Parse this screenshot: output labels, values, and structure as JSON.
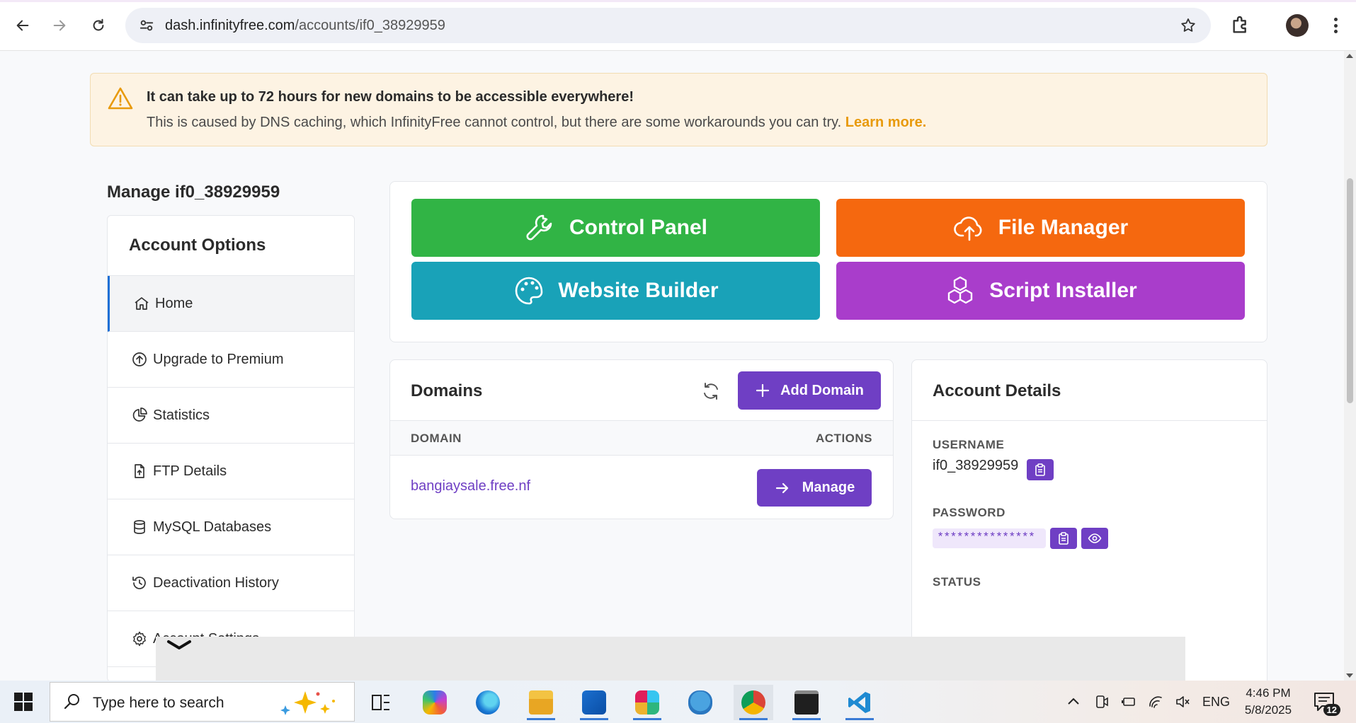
{
  "browser": {
    "url_host": "dash.infinityfree.com",
    "url_path": "/accounts/if0_38929959"
  },
  "alert": {
    "title": "It can take up to 72 hours for new domains to be accessible everywhere!",
    "message": "This is caused by DNS caching, which InfinityFree cannot control, but there are some workarounds you can try. ",
    "link": "Learn more."
  },
  "page_title": "Manage if0_38929959",
  "sidebar": {
    "heading": "Account Options",
    "items": [
      {
        "label": "Home",
        "icon": "home-icon"
      },
      {
        "label": "Upgrade to Premium",
        "icon": "arrow-up-circle-icon"
      },
      {
        "label": "Statistics",
        "icon": "pie-chart-icon"
      },
      {
        "label": "FTP Details",
        "icon": "file-upload-icon"
      },
      {
        "label": "MySQL Databases",
        "icon": "database-icon"
      },
      {
        "label": "Deactivation History",
        "icon": "history-icon"
      },
      {
        "label": "Account Settings",
        "icon": "gear-icon"
      }
    ]
  },
  "actions": {
    "control_panel": "Control Panel",
    "file_manager": "File Manager",
    "website_builder": "Website Builder",
    "script_installer": "Script Installer"
  },
  "domains": {
    "title": "Domains",
    "add_button": "Add Domain",
    "col_domain": "DOMAIN",
    "col_actions": "ACTIONS",
    "rows": [
      {
        "domain": "bangiaysale.free.nf",
        "action": "Manage"
      }
    ]
  },
  "account_details": {
    "title": "Account Details",
    "username_label": "USERNAME",
    "username": "if0_38929959",
    "password_label": "PASSWORD",
    "password_masked": "***************",
    "status_label": "STATUS"
  },
  "taskbar": {
    "search_placeholder": "Type here to search",
    "language": "ENG",
    "time": "4:46 PM",
    "date": "5/8/2025",
    "notifications": "12"
  },
  "colors": {
    "control_panel": "#31b445",
    "file_manager": "#f5680f",
    "website_builder": "#19a2b8",
    "script_installer": "#a93dcb",
    "primary": "#6f3fc4",
    "alert_link": "#e89a0c"
  }
}
